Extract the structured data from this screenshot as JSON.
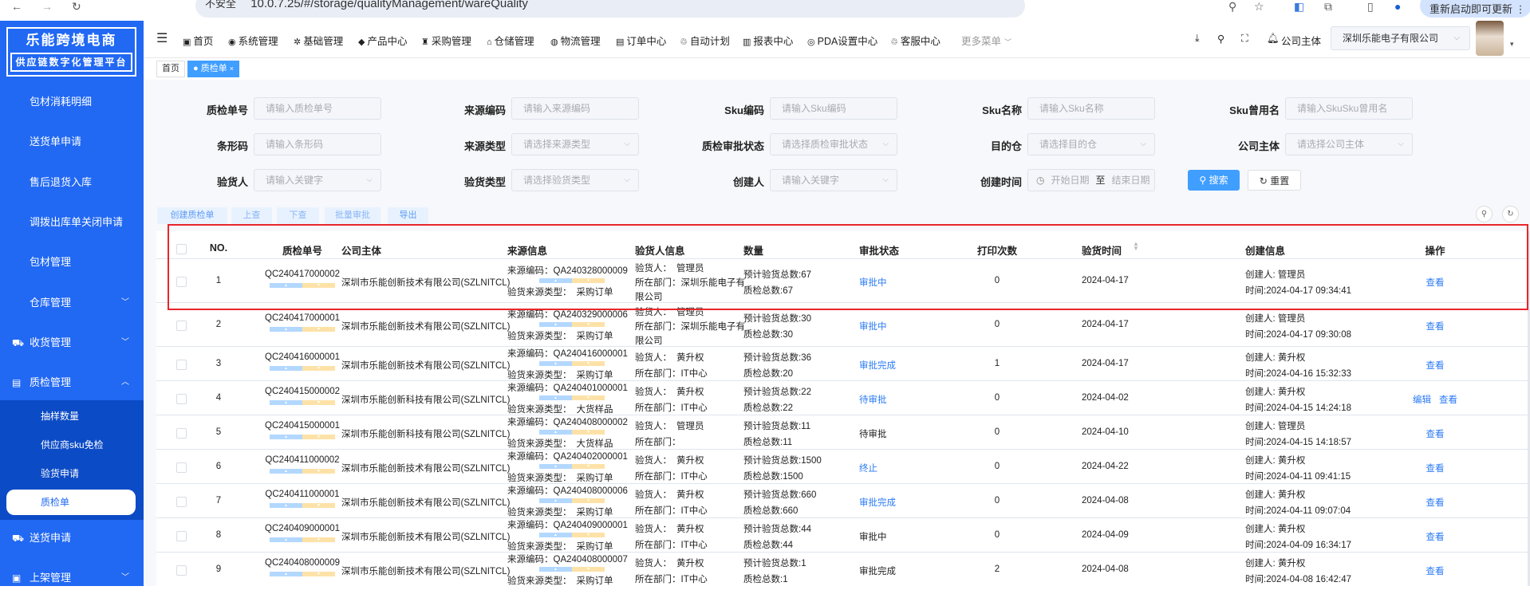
{
  "browser": {
    "security": "不安全",
    "url": "10.0.7.25/#/storage/qualityManagement/wareQuality",
    "update_label": "重新启动即可更新"
  },
  "logo": {
    "line1": "乐能跨境电商",
    "line2": "供应链数字化管理平台"
  },
  "sidebar": {
    "items": [
      {
        "label": "包材消耗明细"
      },
      {
        "label": "送货单申请"
      },
      {
        "label": "售后退货入库"
      },
      {
        "label": "调拨出库单关闭申请"
      },
      {
        "label": "包材管理"
      },
      {
        "label": "仓库管理",
        "chevron": "down"
      },
      {
        "label": "收货管理",
        "icon": "truck-icon",
        "chevron": "down"
      },
      {
        "label": "质检管理",
        "icon": "inspection-icon",
        "chevron": "up"
      }
    ],
    "submenu": [
      {
        "label": "抽样数量"
      },
      {
        "label": "供应商sku免检"
      },
      {
        "label": "验货申请"
      },
      {
        "label": "质检单",
        "active": true
      }
    ],
    "after": [
      {
        "label": "送货申请",
        "icon": "truck-icon"
      },
      {
        "label": "上架管理",
        "icon": "shelf-icon",
        "chevron": "down"
      }
    ]
  },
  "topnav": {
    "items": [
      {
        "label": "首页",
        "icon": "monitor-icon"
      },
      {
        "label": "系统管理",
        "icon": "system-icon"
      },
      {
        "label": "基础管理",
        "icon": "gear-icon"
      },
      {
        "label": "产品中心",
        "icon": "box-icon"
      },
      {
        "label": "采购管理",
        "icon": "purchase-icon"
      },
      {
        "label": "仓储管理",
        "icon": "warehouse-icon"
      },
      {
        "label": "物流管理",
        "icon": "logistics-icon"
      },
      {
        "label": "订单中心",
        "icon": "order-icon"
      },
      {
        "label": "自动计划",
        "icon": "plan-icon"
      },
      {
        "label": "报表中心",
        "icon": "report-icon"
      },
      {
        "label": "PDA设置中心",
        "icon": "globe-icon"
      },
      {
        "label": "客服中心",
        "icon": "service-icon"
      }
    ],
    "more": "更多菜单",
    "company_label": "公司主体",
    "company_value": "深圳乐能电子有限公司"
  },
  "tabs": [
    {
      "label": "首页"
    },
    {
      "label": "质检单",
      "close": "×"
    }
  ],
  "filters": [
    {
      "label": "质检单号",
      "placeholder": "请输入质检单号"
    },
    {
      "label": "来源编码",
      "placeholder": "请输入来源编码"
    },
    {
      "label": "Sku编码",
      "placeholder": "请输入Sku编码"
    },
    {
      "label": "Sku名称",
      "placeholder": "请输入Sku名称"
    },
    {
      "label": "Sku曾用名",
      "placeholder": "请输入SkuSku曾用名"
    },
    {
      "label": "条形码",
      "placeholder": "请输入条形码"
    },
    {
      "label": "来源类型",
      "placeholder": "请选择来源类型",
      "select": true
    },
    {
      "label": "质检审批状态",
      "placeholder": "请选择质检审批状态",
      "select": true
    },
    {
      "label": "目的仓",
      "placeholder": "请选择目的仓",
      "select": true
    },
    {
      "label": "公司主体",
      "placeholder": "请选择公司主体",
      "select": true
    },
    {
      "label": "验货人",
      "placeholder": "请输入关键字",
      "select": true
    },
    {
      "label": "验货类型",
      "placeholder": "请选择验货类型",
      "select": true
    },
    {
      "label": "创建人",
      "placeholder": "请输入关键字",
      "select": true
    },
    {
      "label": "创建时间",
      "start": "开始日期",
      "sep": "至",
      "end": "结束日期"
    }
  ],
  "buttons": {
    "search": "搜索",
    "reset": "重置",
    "create": "创建质检单",
    "prev": "上查",
    "next": "下查",
    "batch": "批量审批",
    "export": "导出"
  },
  "table": {
    "headers": [
      "NO.",
      "质检单号",
      "公司主体",
      "来源信息",
      "验货人信息",
      "数量",
      "审批状态",
      "打印次数",
      "验货时间",
      "创建信息",
      "操作"
    ],
    "labels": {
      "source_code": "来源编码：",
      "source_type": "验货来源类型：",
      "inspector": "验货人：",
      "dept": "所在部门：",
      "expected": "预计验货总数:",
      "qc_total": "质检总数:",
      "creator": "创建人: ",
      "time": "时间:"
    },
    "rows": [
      {
        "no": "1",
        "qc": "QC240417000002",
        "company": "深圳市乐能创新技术有限公司(SZLNITCL)",
        "src": "QA240328000009",
        "type": "采购订单",
        "inspector": "管理员",
        "dept": "深圳乐能电子有限公司",
        "expected": "67",
        "total": "67",
        "status": "审批中",
        "status_link": true,
        "prints": "0",
        "date": "2024-04-17",
        "creator": "管理员",
        "time": "2024-04-17 09:34:41",
        "actions": [
          "查看"
        ]
      },
      {
        "no": "2",
        "qc": "QC240417000001",
        "company": "深圳市乐能创新技术有限公司(SZLNITCL)",
        "src": "QA240329000006",
        "type": "采购订单",
        "inspector": "管理员",
        "dept": "深圳乐能电子有限公司",
        "expected": "30",
        "total": "30",
        "status": "审批中",
        "status_link": true,
        "prints": "0",
        "date": "2024-04-17",
        "creator": "管理员",
        "time": "2024-04-17 09:30:08",
        "actions": [
          "查看"
        ]
      },
      {
        "no": "3",
        "qc": "QC240416000001",
        "company": "深圳市乐能创新技术有限公司(SZLNITCL)",
        "src": "QA240416000001",
        "type": "采购订单",
        "inspector": "黄升权",
        "dept": "IT中心",
        "expected": "36",
        "total": "20",
        "status": "审批完成",
        "status_link": true,
        "prints": "1",
        "date": "2024-04-17",
        "creator": "黄升权",
        "time": "2024-04-16 15:32:33",
        "actions": [
          "查看"
        ]
      },
      {
        "no": "4",
        "qc": "QC240415000002",
        "company": "深圳市乐能创新科技有限公司(SZLNITCL)",
        "src": "QA240401000001",
        "type": "大货样品",
        "inspector": "黄升权",
        "dept": "IT中心",
        "expected": "22",
        "total": "22",
        "status": "待审批",
        "status_link": true,
        "prints": "0",
        "date": "2024-04-02",
        "creator": "黄升权",
        "time": "2024-04-15 14:24:18",
        "actions": [
          "编辑",
          "查看"
        ]
      },
      {
        "no": "5",
        "qc": "QC240415000001",
        "company": "深圳市乐能创新科技有限公司(SZLNITCL)",
        "src": "QA240408000002",
        "type": "大货样品",
        "inspector": "管理员",
        "dept": "",
        "expected": "11",
        "total": "11",
        "status": "待审批",
        "status_link": false,
        "prints": "0",
        "date": "2024-04-10",
        "creator": "管理员",
        "time": "2024-04-15 14:18:57",
        "actions": [
          "查看"
        ]
      },
      {
        "no": "6",
        "qc": "QC240411000002",
        "company": "深圳市乐能创新技术有限公司(SZLNITCL)",
        "src": "QA240402000001",
        "type": "采购订单",
        "inspector": "黄升权",
        "dept": "IT中心",
        "expected": "1500",
        "total": "1500",
        "status": "终止",
        "status_link": true,
        "prints": "0",
        "date": "2024-04-22",
        "creator": "黄升权",
        "time": "2024-04-11 09:41:15",
        "actions": [
          "查看"
        ]
      },
      {
        "no": "7",
        "qc": "QC240411000001",
        "company": "深圳市乐能创新技术有限公司(SZLNITCL)",
        "src": "QA240408000006",
        "type": "采购订单",
        "inspector": "黄升权",
        "dept": "IT中心",
        "expected": "660",
        "total": "660",
        "status": "审批完成",
        "status_link": true,
        "prints": "0",
        "date": "2024-04-08",
        "creator": "黄升权",
        "time": "2024-04-11 09:07:04",
        "actions": [
          "查看"
        ]
      },
      {
        "no": "8",
        "qc": "QC240409000001",
        "company": "深圳市乐能创新技术有限公司(SZLNITCL)",
        "src": "QA240409000001",
        "type": "采购订单",
        "inspector": "黄升权",
        "dept": "IT中心",
        "expected": "44",
        "total": "44",
        "status": "审批中",
        "status_link": false,
        "prints": "0",
        "date": "2024-04-09",
        "creator": "黄升权",
        "time": "2024-04-09 16:34:17",
        "actions": [
          "查看"
        ]
      },
      {
        "no": "9",
        "qc": "QC240408000009",
        "company": "深圳市乐能创新技术有限公司(SZLNITCL)",
        "src": "QA240408000007",
        "type": "采购订单",
        "inspector": "黄升权",
        "dept": "IT中心",
        "expected": "1",
        "total": "1",
        "status": "审批完成",
        "status_link": false,
        "prints": "2",
        "date": "2024-04-08",
        "creator": "黄升权",
        "time": "2024-04-08 16:42:47",
        "actions": [
          "查看"
        ]
      }
    ]
  },
  "colors": {
    "sidebar": "#2168f3",
    "submenu": "#0c4bc6",
    "link": "#2a7af5",
    "highlight": "#e8262b"
  }
}
